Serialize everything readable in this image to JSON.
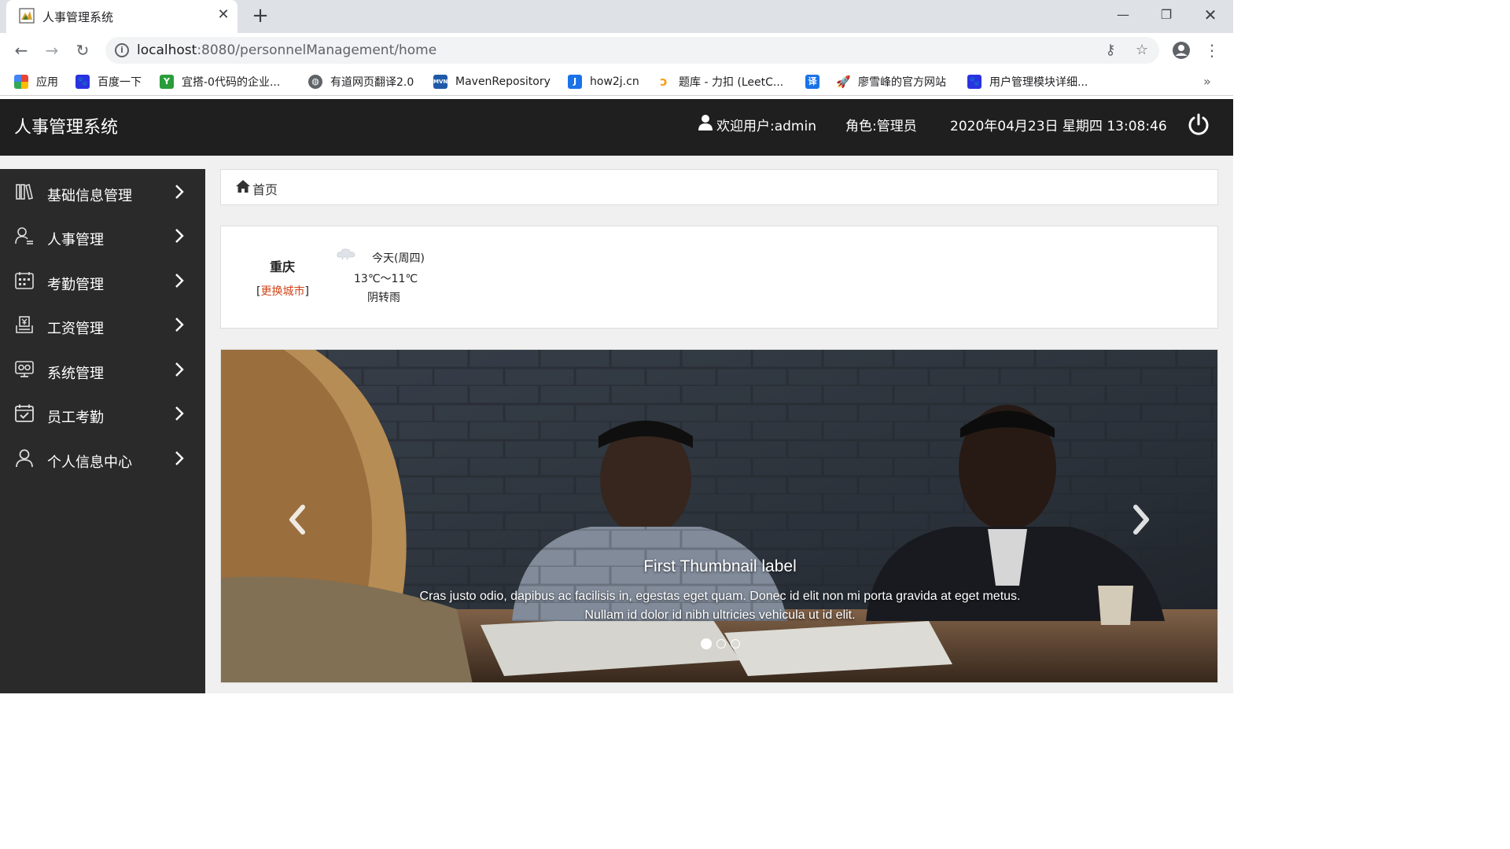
{
  "browser": {
    "tab_title": "人事管理系统",
    "url_host": "localhost",
    "url_path": ":8080/personnelManagement/home",
    "bookmarks": [
      {
        "label": "应用",
        "icon": "apps-grid-icon",
        "color": "#1a73e8"
      },
      {
        "label": "百度一下",
        "icon": "baidu-paw-icon",
        "color": "#2932e1"
      },
      {
        "label": "宜搭-0代码的企业...",
        "icon": "yida-icon",
        "color": "#2a9d3a"
      },
      {
        "label": "有道网页翻译2.0",
        "icon": "globe-icon",
        "color": "#5f6368"
      },
      {
        "label": "MavenRepository",
        "icon": "maven-icon",
        "color": "#1f5aa8"
      },
      {
        "label": "how2j.cn",
        "icon": "how2j-icon",
        "color": "#1a73e8"
      },
      {
        "label": "题库 - 力扣 (LeetC...",
        "icon": "leetcode-icon",
        "color": "#f89f1b"
      },
      {
        "label": "译",
        "icon": "translate-icon",
        "color": "#1a73e8"
      },
      {
        "label": "廖雪峰的官方网站",
        "icon": "rocket-icon",
        "color": "#1a73e8"
      },
      {
        "label": "用户管理模块详细...",
        "icon": "baidu-paw-icon",
        "color": "#2932e1"
      }
    ]
  },
  "header": {
    "title": "人事管理系统",
    "welcome": "欢迎用户:admin",
    "role": "角色:管理员",
    "datetime": "2020年04月23日 星期四 13:08:46"
  },
  "sidebar": {
    "items": [
      {
        "label": "基础信息管理",
        "icon": "books-icon"
      },
      {
        "label": "人事管理",
        "icon": "user-list-icon"
      },
      {
        "label": "考勤管理",
        "icon": "calendar-grid-icon"
      },
      {
        "label": "工资管理",
        "icon": "salary-icon"
      },
      {
        "label": "系统管理",
        "icon": "monitor-settings-icon"
      },
      {
        "label": "员工考勤",
        "icon": "calendar-check-icon"
      },
      {
        "label": "个人信息中心",
        "icon": "person-icon"
      }
    ]
  },
  "breadcrumb": {
    "home": "首页"
  },
  "weather": {
    "city": "重庆",
    "change_city_prefix": "[",
    "change_city_link": "更换城市",
    "change_city_suffix": "]",
    "day": "今天(周四)",
    "temperature": "13℃～11℃",
    "condition": "阴转雨",
    "icon": "cloud-rain-icon"
  },
  "carousel": {
    "caption_title": "First Thumbnail label",
    "caption_text": "Cras justo odio, dapibus ac facilisis in, egestas eget quam. Donec id elit non mi porta gravida at eget metus. Nullam id dolor id nibh ultricies vehicula ut id elit.",
    "slide_count": 3,
    "active_slide": 1
  }
}
